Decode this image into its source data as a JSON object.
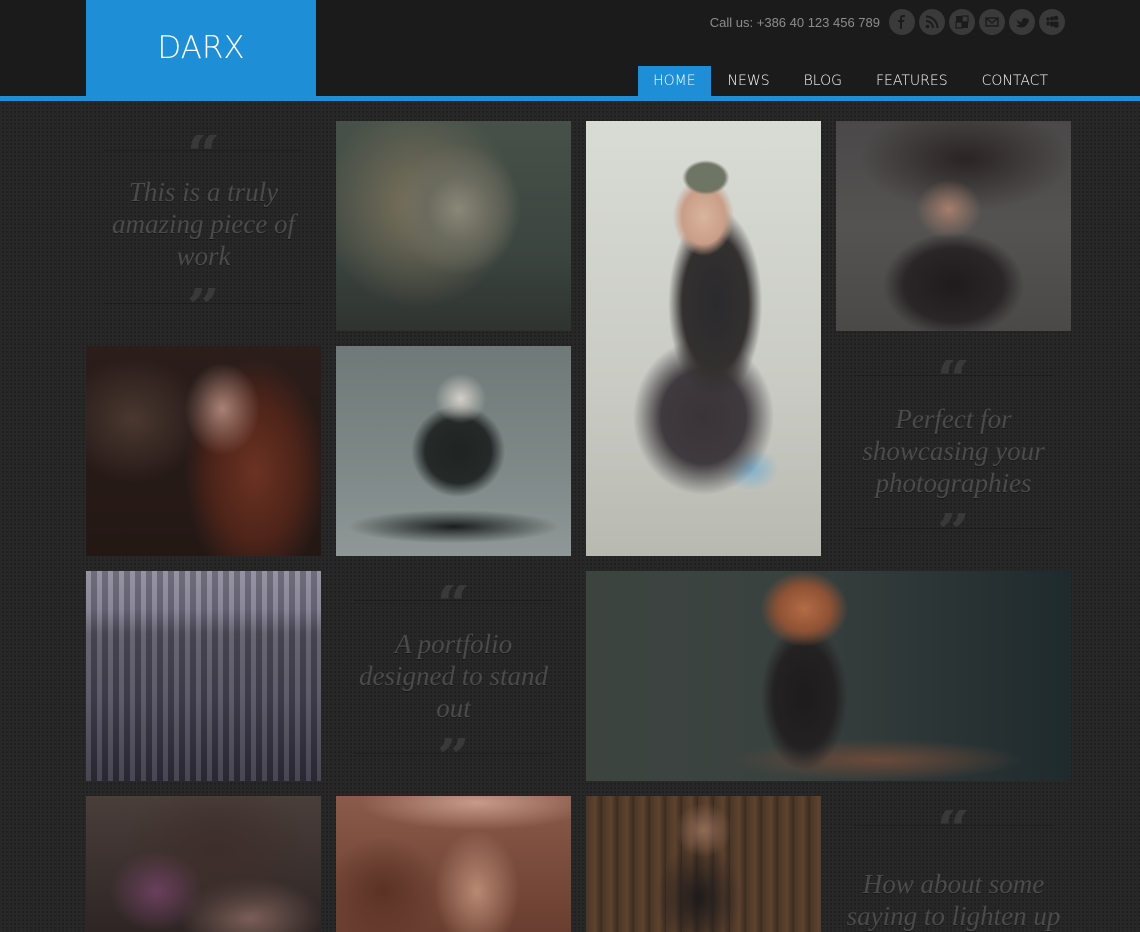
{
  "logo": "DARX",
  "contact": {
    "call_text": "Call us: +386 40 123 456 789"
  },
  "social_icons": [
    "facebook-icon",
    "rss-icon",
    "delicious-icon",
    "mail-icon",
    "twitter-icon",
    "myspace-icon"
  ],
  "nav": [
    {
      "label": "HOME",
      "active": true
    },
    {
      "label": "NEWS",
      "active": false
    },
    {
      "label": "BLOG",
      "active": false
    },
    {
      "label": "FEATURES",
      "active": false
    },
    {
      "label": "CONTACT",
      "active": false
    }
  ],
  "quotes": [
    "This is a truly amazing piece of work",
    "Perfect for showcasing your photographies",
    "A portfolio designed to stand out",
    "How about some saying to lighten up"
  ],
  "photos": [
    "curly-blonde-portrait",
    "woman-hair-flip",
    "woman-green-hat-sitting",
    "red-hair-profile",
    "blonde-posing-floor",
    "city-skyline",
    "redhead-leaning",
    "curly-hair-closeup",
    "woman-with-hat",
    "woman-rusty-wall"
  ],
  "colors": {
    "accent": "#1e8fd6",
    "header_bg": "#1b1b1b",
    "body_bg": "#262626"
  }
}
